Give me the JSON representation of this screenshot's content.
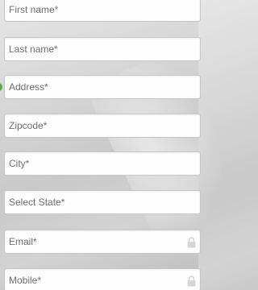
{
  "form": {
    "fields": [
      {
        "placeholder": "First name*",
        "value": ""
      },
      {
        "placeholder": "Last name*",
        "value": ""
      },
      {
        "placeholder": "Address*",
        "value": ""
      },
      {
        "placeholder": "Zipcode*",
        "value": ""
      },
      {
        "placeholder": "City*",
        "value": ""
      },
      {
        "placeholder": "Select State*",
        "value": ""
      },
      {
        "placeholder": "Email*",
        "value": "",
        "icon": "lock-icon"
      },
      {
        "placeholder": "Mobile*",
        "value": "",
        "icon": "lock-icon"
      }
    ]
  },
  "colors": {
    "field_bg": "#fdfdfd",
    "field_border": "#c6c6c6",
    "placeholder_text": "#6f6f6f",
    "valid_indicator": "#5aa84a",
    "lock_icon": "#d6d6d6"
  }
}
